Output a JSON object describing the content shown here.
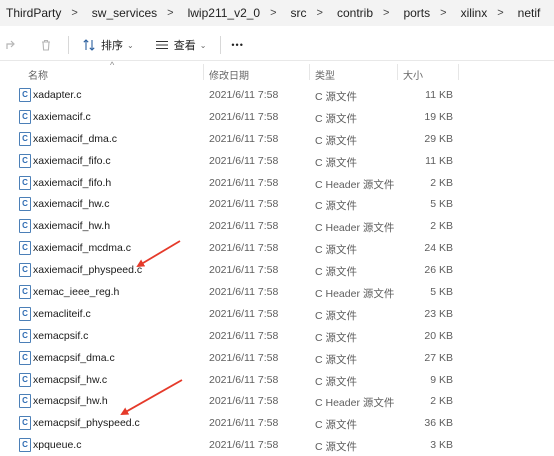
{
  "breadcrumb": [
    "ThirdParty",
    "sw_services",
    "lwip211_v2_0",
    "src",
    "contrib",
    "ports",
    "xilinx",
    "netif"
  ],
  "toolbar": {
    "sort_label": "排序",
    "view_label": "查看",
    "more_label": "•••"
  },
  "columns": {
    "name": "名称",
    "date": "修改日期",
    "type": "类型",
    "size": "大小"
  },
  "files": [
    {
      "name": "xadapter.c",
      "date": "2021/6/11 7:58",
      "type": "C 源文件",
      "size": "11 KB",
      "icon": "c-file-icon"
    },
    {
      "name": "xaxiemacif.c",
      "date": "2021/6/11 7:58",
      "type": "C 源文件",
      "size": "19 KB",
      "icon": "c-file-icon"
    },
    {
      "name": "xaxiemacif_dma.c",
      "date": "2021/6/11 7:58",
      "type": "C 源文件",
      "size": "29 KB",
      "icon": "c-file-icon"
    },
    {
      "name": "xaxiemacif_fifo.c",
      "date": "2021/6/11 7:58",
      "type": "C 源文件",
      "size": "11 KB",
      "icon": "c-file-icon"
    },
    {
      "name": "xaxiemacif_fifo.h",
      "date": "2021/6/11 7:58",
      "type": "C Header 源文件",
      "size": "2 KB",
      "icon": "h-file-icon"
    },
    {
      "name": "xaxiemacif_hw.c",
      "date": "2021/6/11 7:58",
      "type": "C 源文件",
      "size": "5 KB",
      "icon": "c-file-icon"
    },
    {
      "name": "xaxiemacif_hw.h",
      "date": "2021/6/11 7:58",
      "type": "C Header 源文件",
      "size": "2 KB",
      "icon": "h-file-icon"
    },
    {
      "name": "xaxiemacif_mcdma.c",
      "date": "2021/6/11 7:58",
      "type": "C 源文件",
      "size": "24 KB",
      "icon": "c-file-icon"
    },
    {
      "name": "xaxiemacif_physpeed.c",
      "date": "2021/6/11 7:58",
      "type": "C 源文件",
      "size": "26 KB",
      "icon": "c-file-icon"
    },
    {
      "name": "xemac_ieee_reg.h",
      "date": "2021/6/11 7:58",
      "type": "C Header 源文件",
      "size": "5 KB",
      "icon": "h-file-icon"
    },
    {
      "name": "xemacliteif.c",
      "date": "2021/6/11 7:58",
      "type": "C 源文件",
      "size": "23 KB",
      "icon": "c-file-icon"
    },
    {
      "name": "xemacpsif.c",
      "date": "2021/6/11 7:58",
      "type": "C 源文件",
      "size": "20 KB",
      "icon": "c-file-icon"
    },
    {
      "name": "xemacpsif_dma.c",
      "date": "2021/6/11 7:58",
      "type": "C 源文件",
      "size": "27 KB",
      "icon": "c-file-icon"
    },
    {
      "name": "xemacpsif_hw.c",
      "date": "2021/6/11 7:58",
      "type": "C 源文件",
      "size": "9 KB",
      "icon": "c-file-icon"
    },
    {
      "name": "xemacpsif_hw.h",
      "date": "2021/6/11 7:58",
      "type": "C Header 源文件",
      "size": "2 KB",
      "icon": "h-file-icon"
    },
    {
      "name": "xemacpsif_physpeed.c",
      "date": "2021/6/11 7:58",
      "type": "C 源文件",
      "size": "36 KB",
      "icon": "c-file-icon"
    },
    {
      "name": "xpqueue.c",
      "date": "2021/6/11 7:58",
      "type": "C 源文件",
      "size": "3 KB",
      "icon": "c-file-icon"
    }
  ],
  "annotation_color": "#e53a2a",
  "accent_color": "#2f6cb3"
}
